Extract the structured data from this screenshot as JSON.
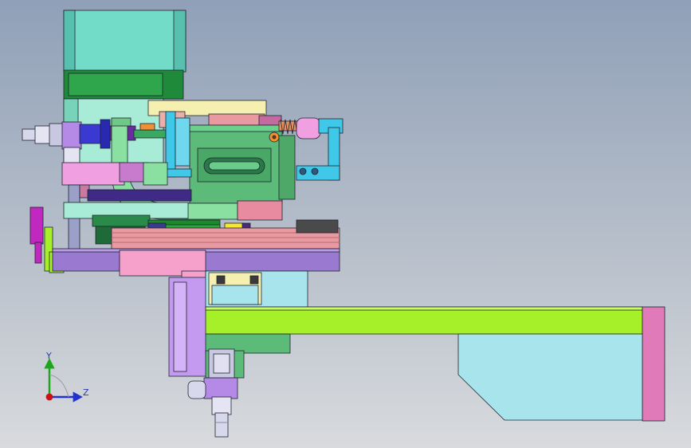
{
  "viewport": {
    "background_top": "#90a0b8",
    "background_bottom": "#d8dadd"
  },
  "triad": {
    "y_label": "Y",
    "z_label": "Z",
    "y_color": "#1aa81a",
    "z_color": "#2233cc",
    "x_color": "#cc1111"
  },
  "colors": {
    "motor_teal": "#72dcc8",
    "motor_green": "#1f8a3a",
    "lime_arm": "#a6f02a",
    "cyan_block": "#a8e4ec",
    "purple_plate": "#9a7ad0",
    "pink": "#f6a0cc",
    "magenta_end": "#e07ab8",
    "salmon_stack": "#e89aa0",
    "cream": "#f6f0b0",
    "lavender": "#c49af0",
    "dark_green": "#5cbb78"
  }
}
